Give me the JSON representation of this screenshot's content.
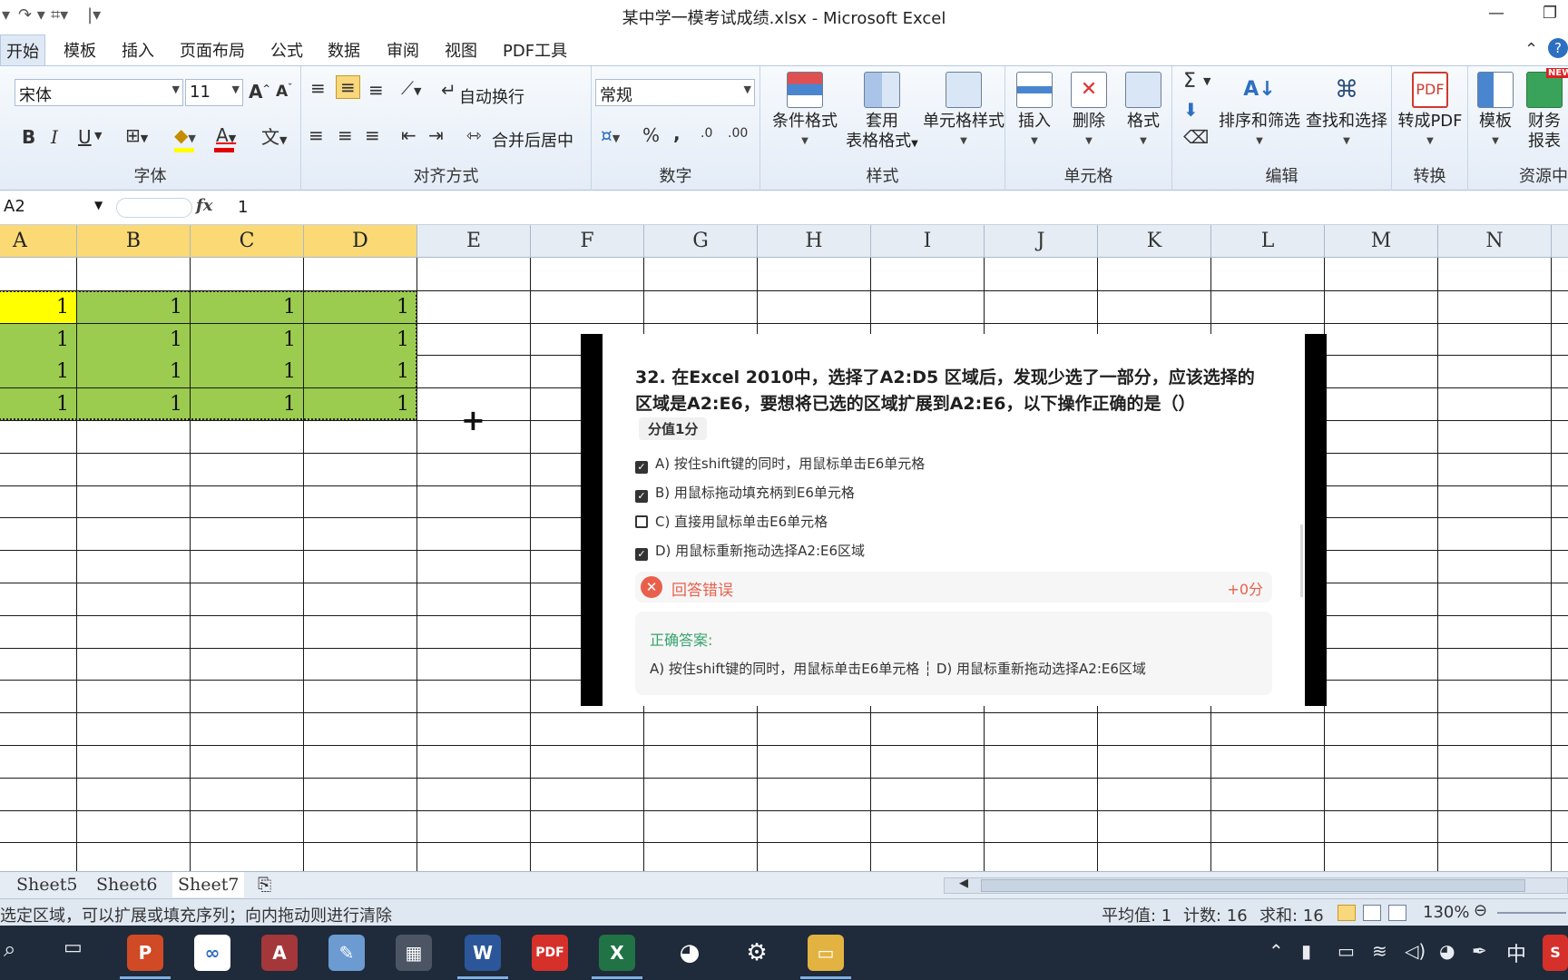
{
  "titlebar": {
    "title": "某中学一模考试成绩.xlsx - Microsoft Excel",
    "minimize": "—",
    "restore": "❐"
  },
  "tabs": [
    "开始",
    "模板",
    "插入",
    "页面布局",
    "公式",
    "数据",
    "审阅",
    "视图",
    "PDF工具"
  ],
  "ribbon": {
    "font": {
      "name": "宋体",
      "size": "11",
      "bold": "B",
      "italic": "I",
      "underline": "U",
      "label": "字体"
    },
    "align": {
      "wrap": "自动换行",
      "merge": "合并后居中",
      "label": "对齐方式"
    },
    "number": {
      "format": "常规",
      "percent": "%",
      "comma": ",",
      "label": "数字"
    },
    "styles": {
      "conditional": "条件格式",
      "table_fmt_1": "套用",
      "table_fmt_2": "表格格式",
      "cell_style": "单元格样式",
      "label": "样式"
    },
    "cells": {
      "insert": "插入",
      "delete": "删除",
      "format": "格式",
      "label": "单元格"
    },
    "edit": {
      "sigma": "Σ",
      "sort": "排序和筛选",
      "find": "查找和选择",
      "label": "编辑"
    },
    "convert": {
      "to_pdf": "转成PDF",
      "label": "转换"
    },
    "resources": {
      "template": "模板",
      "finance_1": "财务",
      "finance_2": "报表",
      "label": "资源中",
      "new_badge": "NEW"
    }
  },
  "formula_bar": {
    "name_box": "A2",
    "fx": "fx",
    "value": "1"
  },
  "grid": {
    "columns": [
      "A",
      "B",
      "C",
      "D",
      "E",
      "F",
      "G",
      "H",
      "I",
      "J",
      "K",
      "L",
      "M",
      "N"
    ],
    "selected_columns": [
      "A",
      "B",
      "C",
      "D"
    ],
    "rows": [
      [
        "1",
        "1",
        "1",
        "1"
      ],
      [
        "1",
        "1",
        "1",
        "1"
      ],
      [
        "1",
        "1",
        "1",
        "1"
      ],
      [
        "1",
        "1",
        "1",
        "1"
      ]
    ],
    "active_color": "#ffff00",
    "fill_color": "#9bcb4f",
    "cursor": "+"
  },
  "quiz": {
    "question_line1": "32. 在Excel 2010中，选择了A2:D5 区域后，发现少选了一部分，应该选择的",
    "question_line2": "区域是A2:E6，要想将已选的区域扩展到A2:E6，以下操作正确的是（）",
    "score": "分值1分",
    "options": [
      {
        "text": "A) 按住shift键的同时，用鼠标单击E6单元格",
        "checked": true
      },
      {
        "text": "B) 用鼠标拖动填充柄到E6单元格",
        "checked": true
      },
      {
        "text": "C) 直接用鼠标单击E6单元格",
        "checked": false
      },
      {
        "text": "D) 用鼠标重新拖动选择A2:E6区域",
        "checked": true
      }
    ],
    "result_text": "回答错误",
    "result_score": "+0分",
    "answer_label": "正确答案:",
    "answer_text": "A) 按住shift键的同时，用鼠标单击E6单元格 ┆ D) 用鼠标重新拖动选择A2:E6区域"
  },
  "sheets": [
    "Sheet5",
    "Sheet6",
    "Sheet7"
  ],
  "active_sheet": "Sheet7",
  "status": {
    "message": "选定区域，可以扩展或填充序列；向内拖动则进行清除",
    "average": "平均值: 1",
    "count": "计数: 16",
    "sum": "求和: 16",
    "zoom": "130%"
  },
  "taskbar": {
    "icons": [
      "search-icon",
      "task-view-icon",
      "powerpoint-icon",
      "baidu-netdisk-icon",
      "access-icon",
      "paint-icon",
      "calculator-icon",
      "word-icon",
      "pdf-icon",
      "excel-icon",
      "qq-icon",
      "settings-icon",
      "file-explorer-icon"
    ],
    "ime": "中"
  }
}
